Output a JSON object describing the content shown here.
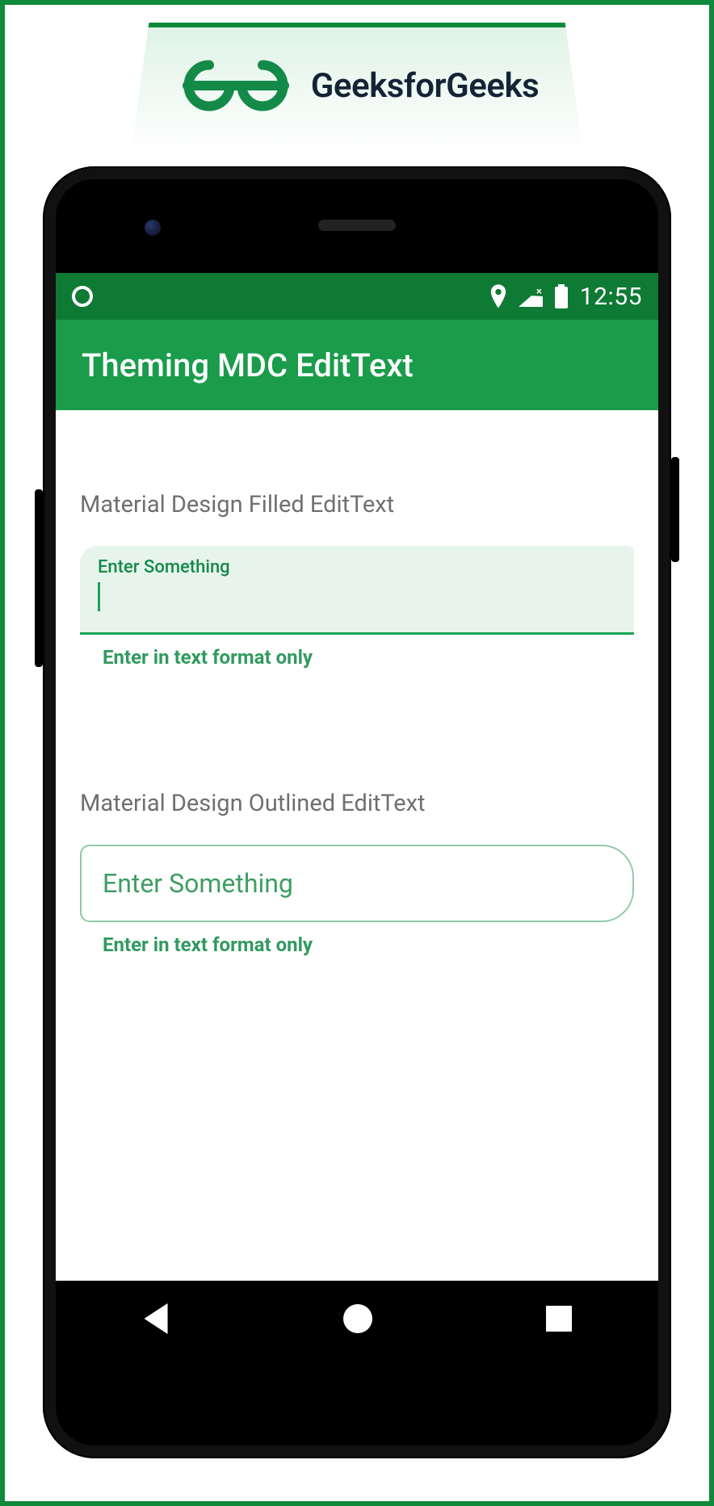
{
  "brand": {
    "name": "GeeksforGeeks"
  },
  "statusbar": {
    "time": "12:55"
  },
  "appbar": {
    "title": "Theming MDC EditText"
  },
  "filled": {
    "section_label": "Material Design Filled EditText",
    "hint": "Enter Something",
    "helper": "Enter in text format only",
    "value": ""
  },
  "outlined": {
    "section_label": "Material Design Outlined EditText",
    "hint": "Enter Something",
    "helper": "Enter in text format only",
    "value": ""
  },
  "colors": {
    "accent": "#0f893a",
    "appbar": "#1a9c4b",
    "statusbar": "#0f7a34",
    "field_fill": "#e7f4ec"
  }
}
